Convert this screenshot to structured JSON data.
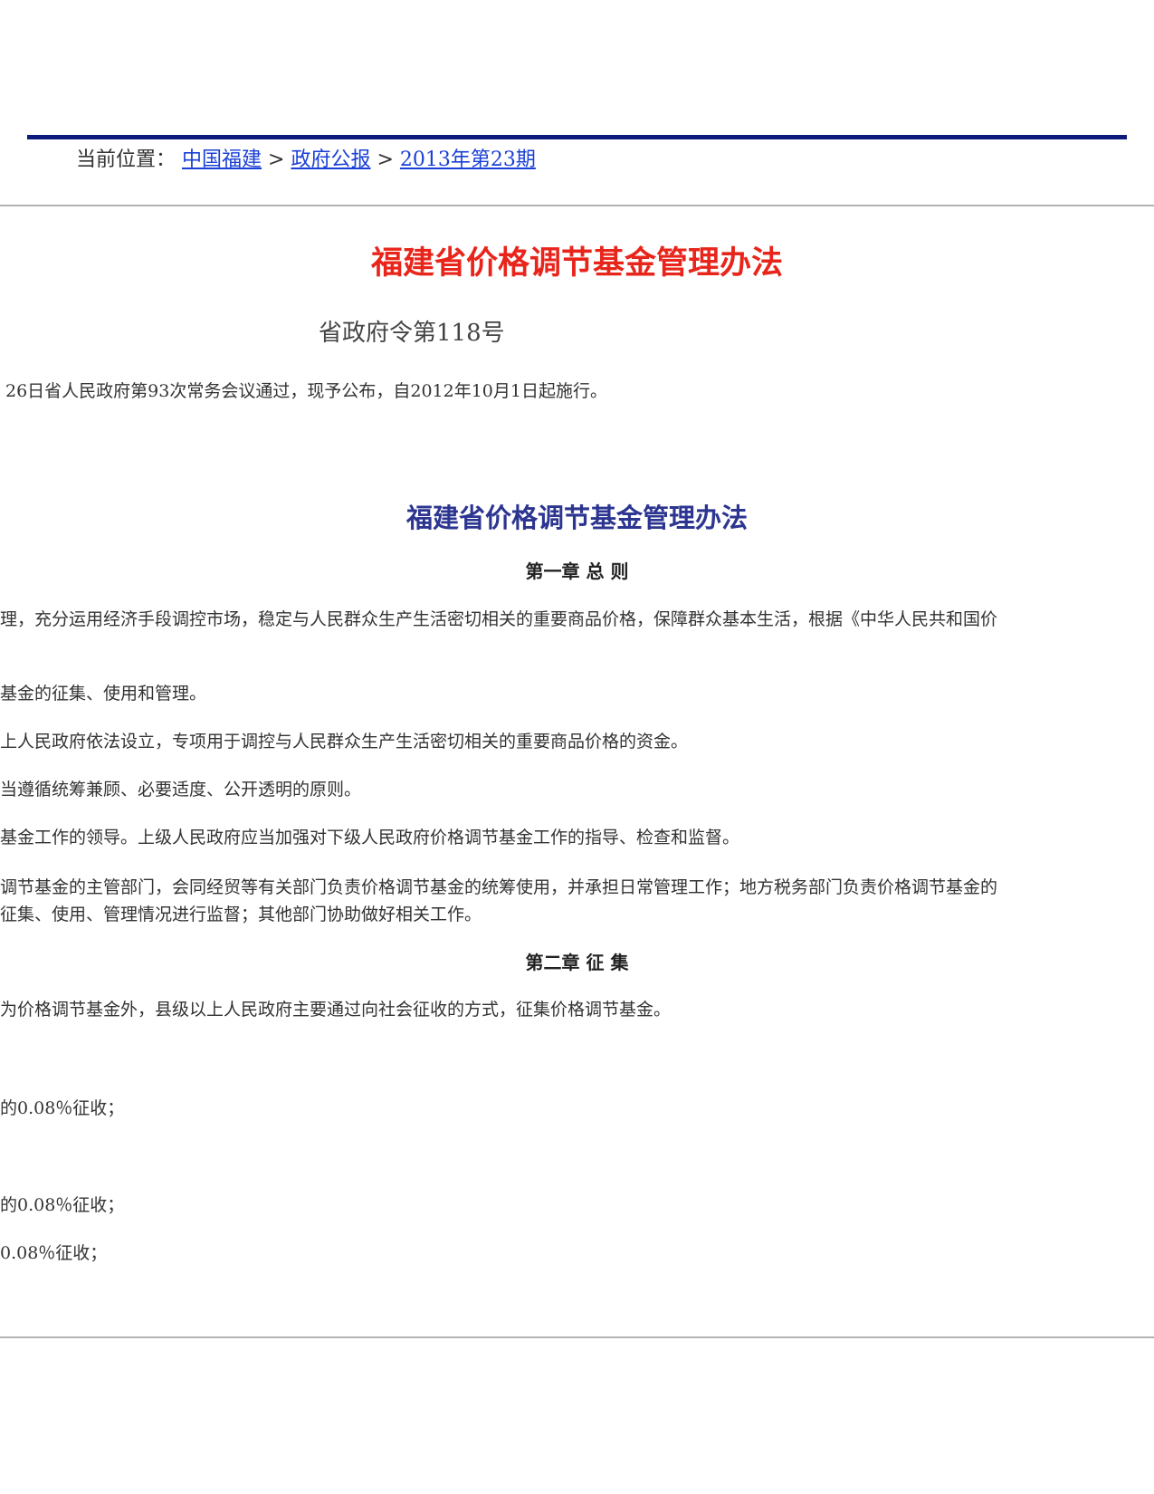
{
  "breadcrumb": {
    "prefix": "当前位置：",
    "items": [
      {
        "label": "中国福建"
      },
      {
        "label": "政府公报"
      },
      {
        "label": "2013年第23期"
      }
    ],
    "separator": ">"
  },
  "document": {
    "title_red": "福建省价格调节基金管理办法",
    "order_no": "省政府令第118号",
    "promulgation_line": "26日省人民政府第93次常务会议通过，现予公布，自2012年10月1日起施行。",
    "title_blue": "福建省价格调节基金管理办法",
    "chapter1_heading": "第一章  总  则",
    "chapter1_lines": [
      "理，充分运用经济手段调控市场，稳定与人民群众生产生活密切相关的重要商品价格，保障群众基本生活，根据《中华人民共和国价",
      "基金的征集、使用和管理。",
      "上人民政府依法设立，专项用于调控与人民群众生产生活密切相关的重要商品价格的资金。",
      "当遵循统筹兼顾、必要适度、公开透明的原则。",
      "基金工作的领导。上级人民政府应当加强对下级人民政府价格调节基金工作的指导、检查和监督。",
      "调节基金的主管部门，会同经贸等有关部门负责价格调节基金的统筹使用，并承担日常管理工作；地方税务部门负责价格调节基金的",
      "征集、使用、管理情况进行监督；其他部门协助做好相关工作。"
    ],
    "chapter2_heading": "第二章  征  集",
    "chapter2_lines": [
      "为价格调节基金外，县级以上人民政府主要通过向社会征收的方式，征集价格调节基金。",
      "的0.08％征收；",
      "的0.08％征收；",
      "0.08％征收；"
    ]
  },
  "colors": {
    "top_rule": "#0d1a7a",
    "link": "#1a3fd6",
    "title_red": "#e8251b",
    "title_blue": "#2c3590",
    "divider": "#b3b3b3"
  }
}
